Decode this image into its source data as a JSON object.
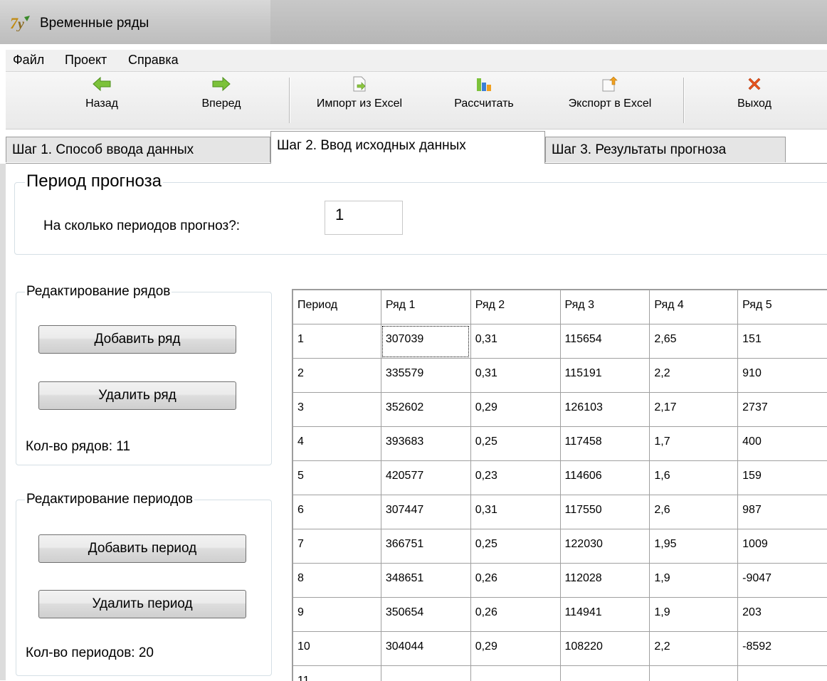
{
  "window": {
    "title": "Временные ряды"
  },
  "menu": [
    "Файл",
    "Проект",
    "Справка"
  ],
  "toolbar": {
    "back": "Назад",
    "forward": "Вперед",
    "import": "Импорт из Excel",
    "calculate": "Рассчитать",
    "export": "Экспорт в Excel",
    "exit": "Выход"
  },
  "tabs": [
    "Шаг 1. Способ ввода данных",
    "Шаг 2. Ввод исходных данных",
    "Шаг 3. Результаты прогноза"
  ],
  "forecast": {
    "group_title": "Период прогноза",
    "label": "На сколько периодов прогноз?:",
    "value": "1"
  },
  "series_edit": {
    "group_title": "Редактирование рядов",
    "add": "Добавить ряд",
    "remove": "Удалить ряд",
    "count": "Кол-во рядов: 11"
  },
  "period_edit": {
    "group_title": "Редактирование периодов",
    "add": "Добавить период",
    "remove": "Удалить период",
    "count": "Кол-во периодов: 20"
  },
  "grid": {
    "columns": [
      "Период",
      "Ряд 1",
      "Ряд 2",
      "Ряд 3",
      "Ряд 4",
      "Ряд 5"
    ],
    "rows": [
      [
        "1",
        "307039",
        "0,31",
        "115654",
        "2,65",
        "151"
      ],
      [
        "2",
        "335579",
        "0,31",
        "115191",
        "2,2",
        "910"
      ],
      [
        "3",
        "352602",
        "0,29",
        "126103",
        "2,17",
        "2737"
      ],
      [
        "4",
        "393683",
        "0,25",
        "117458",
        "1,7",
        "400"
      ],
      [
        "5",
        "420577",
        "0,23",
        "114606",
        "1,6",
        "159"
      ],
      [
        "6",
        "307447",
        "0,31",
        "117550",
        "2,6",
        "987"
      ],
      [
        "7",
        "366751",
        "0,25",
        "122030",
        "1,95",
        "1009"
      ],
      [
        "8",
        "348651",
        "0,26",
        "112028",
        "1,9",
        "-9047"
      ],
      [
        "9",
        "350654",
        "0,26",
        "114941",
        "1,9",
        "203"
      ],
      [
        "10",
        "304044",
        "0,29",
        "108220",
        "2,2",
        "-8592"
      ],
      [
        "11",
        "",
        "",
        "",
        "",
        ""
      ]
    ]
  }
}
